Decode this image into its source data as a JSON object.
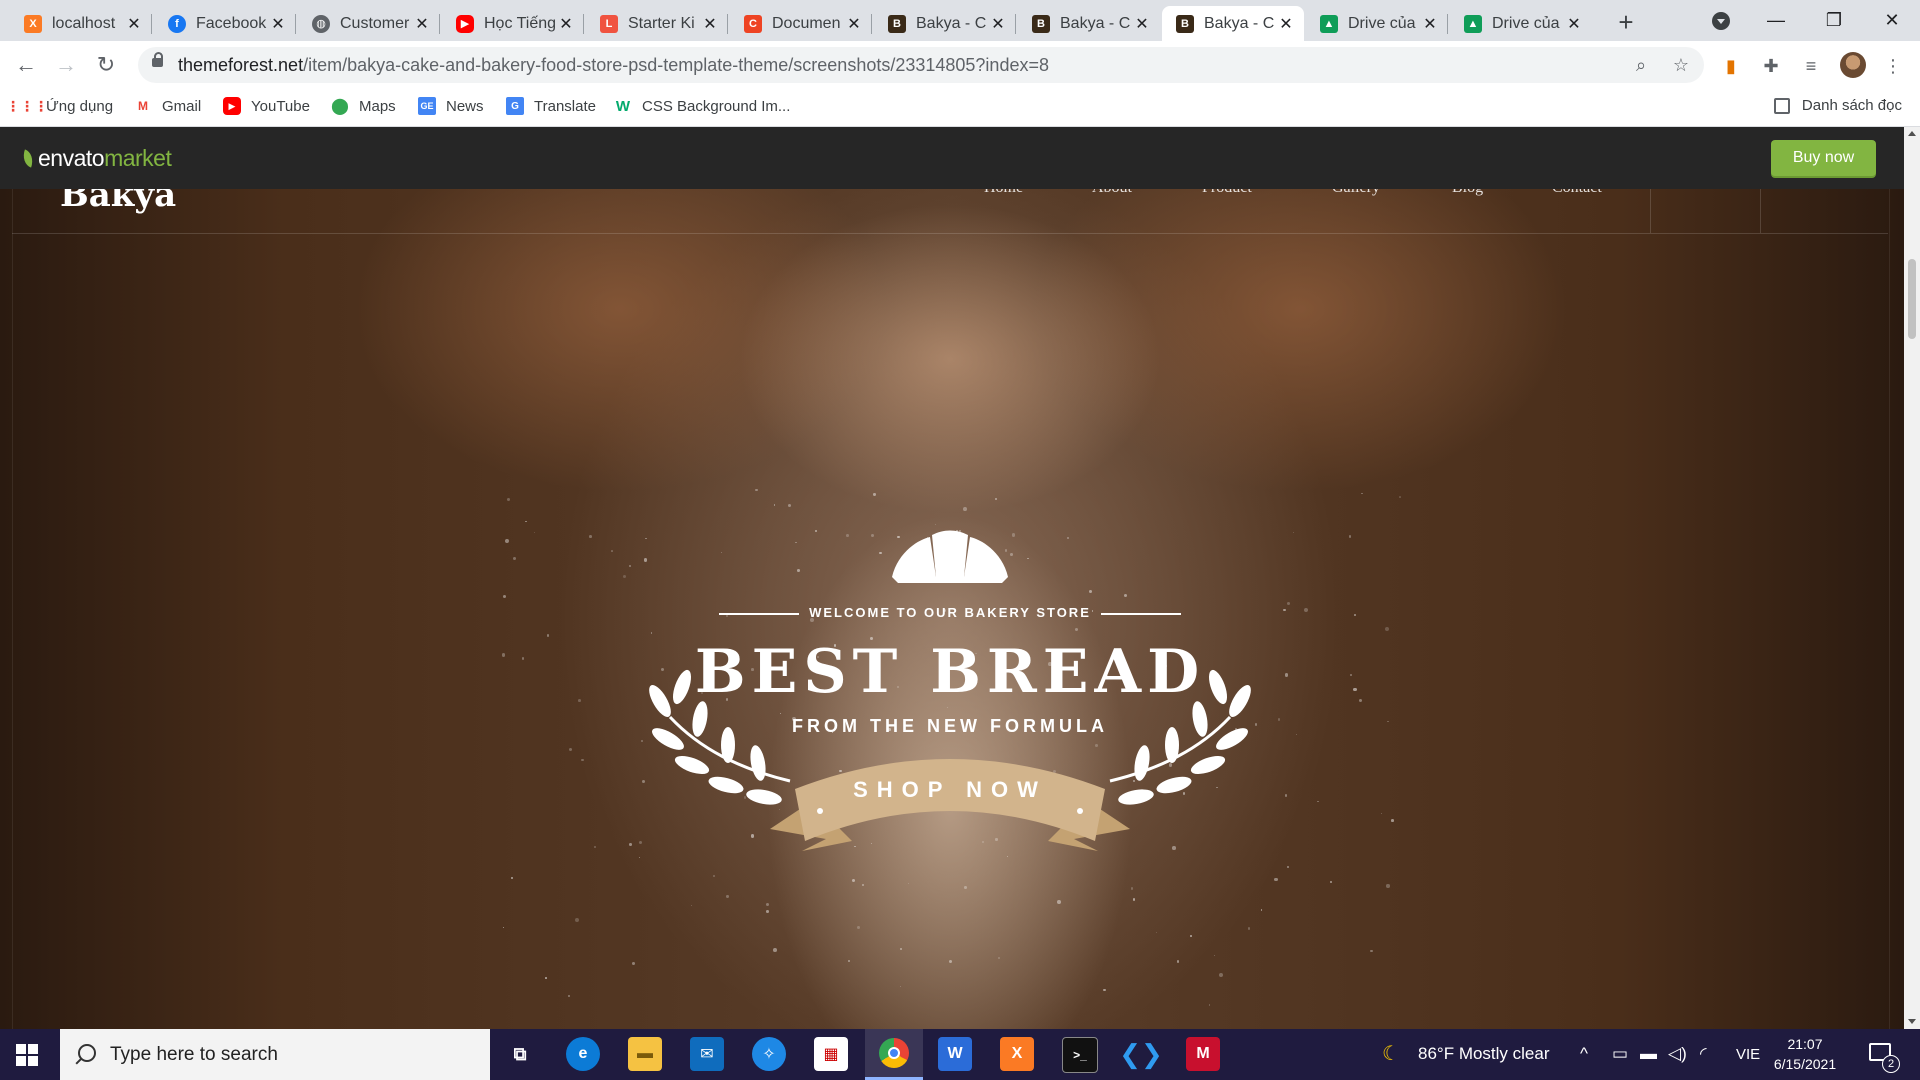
{
  "browser": {
    "tabs": [
      {
        "title": "localhost",
        "favicon": "xampp-icon",
        "color": "#fb7a24"
      },
      {
        "title": "Facebook",
        "favicon": "facebook-icon",
        "color": "#1877f2"
      },
      {
        "title": "Customer",
        "favicon": "globe-icon",
        "color": "#5f6368"
      },
      {
        "title": "Học Tiếng",
        "favicon": "youtube-icon",
        "color": "#ff0000"
      },
      {
        "title": "Starter Ki",
        "favicon": "laravel-icon",
        "color": "#f05340"
      },
      {
        "title": "Documen",
        "favicon": "codeigniter-icon",
        "color": "#ee4323"
      },
      {
        "title": "Bakya - C",
        "favicon": "bakya-icon",
        "color": "#3a2a18"
      },
      {
        "title": "Bakya - C",
        "favicon": "bakya-icon",
        "color": "#3a2a18"
      },
      {
        "title": "Bakya - C",
        "favicon": "bakya-icon",
        "color": "#3a2a18",
        "active": true
      },
      {
        "title": "Drive của",
        "favicon": "google-drive-icon",
        "color": "#0f9d58"
      },
      {
        "title": "Drive của",
        "favicon": "google-drive-icon",
        "color": "#0f9d58"
      }
    ],
    "url_host": "themeforest.net",
    "url_path": "/item/bakya-cake-and-bakery-food-store-psd-template-theme/screenshots/23314805?index=8",
    "bookmarks": [
      {
        "label": "Ứng dụng",
        "icon": "apps-grid-icon"
      },
      {
        "label": "Gmail",
        "icon": "gmail-icon"
      },
      {
        "label": "YouTube",
        "icon": "youtube-icon"
      },
      {
        "label": "Maps",
        "icon": "maps-pin-icon"
      },
      {
        "label": "News",
        "icon": "google-news-icon"
      },
      {
        "label": "Translate",
        "icon": "google-translate-icon"
      },
      {
        "label": "CSS Background Im...",
        "icon": "w3schools-icon"
      }
    ],
    "reading_list": "Danh sách đọc"
  },
  "envato": {
    "logo_main": "envato",
    "logo_market": "market",
    "buy_now": "Buy now",
    "accent": "#82b541"
  },
  "site": {
    "logo": "Bakya",
    "nav": [
      "Home",
      "About",
      "Product",
      "Gallery",
      "Blog",
      "Contact"
    ]
  },
  "hero": {
    "welcome": "WELCOME TO OUR BAKERY STORE",
    "headline": "BEST BREAD",
    "subheadline": "FROM THE NEW FORMULA",
    "cta": "SHOP NOW",
    "ribbon_color": "#d2b48c"
  },
  "taskbar": {
    "search_placeholder": "Type here to search",
    "weather": "86°F  Mostly clear",
    "language": "VIE",
    "time": "21:07",
    "date": "6/15/2021",
    "notifications": "2"
  }
}
